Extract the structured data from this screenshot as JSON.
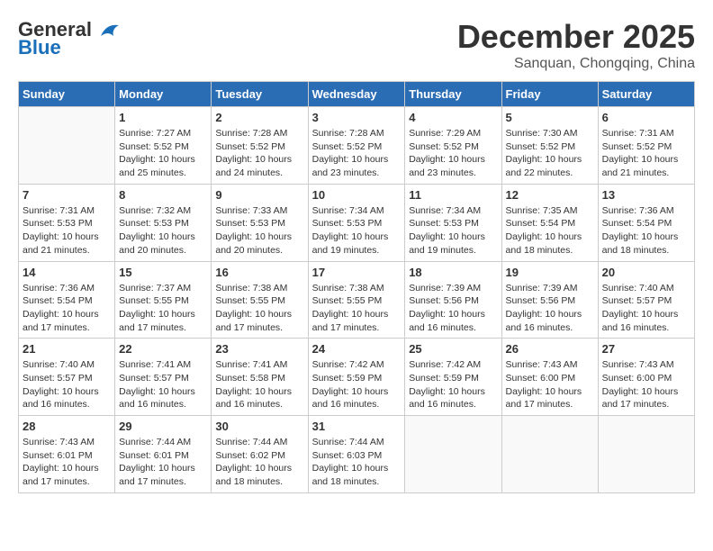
{
  "header": {
    "logo_line1": "General",
    "logo_line2": "Blue",
    "month": "December 2025",
    "location": "Sanquan, Chongqing, China"
  },
  "weekdays": [
    "Sunday",
    "Monday",
    "Tuesday",
    "Wednesday",
    "Thursday",
    "Friday",
    "Saturday"
  ],
  "weeks": [
    [
      {
        "day": "",
        "info": ""
      },
      {
        "day": "1",
        "info": "Sunrise: 7:27 AM\nSunset: 5:52 PM\nDaylight: 10 hours\nand 25 minutes."
      },
      {
        "day": "2",
        "info": "Sunrise: 7:28 AM\nSunset: 5:52 PM\nDaylight: 10 hours\nand 24 minutes."
      },
      {
        "day": "3",
        "info": "Sunrise: 7:28 AM\nSunset: 5:52 PM\nDaylight: 10 hours\nand 23 minutes."
      },
      {
        "day": "4",
        "info": "Sunrise: 7:29 AM\nSunset: 5:52 PM\nDaylight: 10 hours\nand 23 minutes."
      },
      {
        "day": "5",
        "info": "Sunrise: 7:30 AM\nSunset: 5:52 PM\nDaylight: 10 hours\nand 22 minutes."
      },
      {
        "day": "6",
        "info": "Sunrise: 7:31 AM\nSunset: 5:52 PM\nDaylight: 10 hours\nand 21 minutes."
      }
    ],
    [
      {
        "day": "7",
        "info": "Sunrise: 7:31 AM\nSunset: 5:53 PM\nDaylight: 10 hours\nand 21 minutes."
      },
      {
        "day": "8",
        "info": "Sunrise: 7:32 AM\nSunset: 5:53 PM\nDaylight: 10 hours\nand 20 minutes."
      },
      {
        "day": "9",
        "info": "Sunrise: 7:33 AM\nSunset: 5:53 PM\nDaylight: 10 hours\nand 20 minutes."
      },
      {
        "day": "10",
        "info": "Sunrise: 7:34 AM\nSunset: 5:53 PM\nDaylight: 10 hours\nand 19 minutes."
      },
      {
        "day": "11",
        "info": "Sunrise: 7:34 AM\nSunset: 5:53 PM\nDaylight: 10 hours\nand 19 minutes."
      },
      {
        "day": "12",
        "info": "Sunrise: 7:35 AM\nSunset: 5:54 PM\nDaylight: 10 hours\nand 18 minutes."
      },
      {
        "day": "13",
        "info": "Sunrise: 7:36 AM\nSunset: 5:54 PM\nDaylight: 10 hours\nand 18 minutes."
      }
    ],
    [
      {
        "day": "14",
        "info": "Sunrise: 7:36 AM\nSunset: 5:54 PM\nDaylight: 10 hours\nand 17 minutes."
      },
      {
        "day": "15",
        "info": "Sunrise: 7:37 AM\nSunset: 5:55 PM\nDaylight: 10 hours\nand 17 minutes."
      },
      {
        "day": "16",
        "info": "Sunrise: 7:38 AM\nSunset: 5:55 PM\nDaylight: 10 hours\nand 17 minutes."
      },
      {
        "day": "17",
        "info": "Sunrise: 7:38 AM\nSunset: 5:55 PM\nDaylight: 10 hours\nand 17 minutes."
      },
      {
        "day": "18",
        "info": "Sunrise: 7:39 AM\nSunset: 5:56 PM\nDaylight: 10 hours\nand 16 minutes."
      },
      {
        "day": "19",
        "info": "Sunrise: 7:39 AM\nSunset: 5:56 PM\nDaylight: 10 hours\nand 16 minutes."
      },
      {
        "day": "20",
        "info": "Sunrise: 7:40 AM\nSunset: 5:57 PM\nDaylight: 10 hours\nand 16 minutes."
      }
    ],
    [
      {
        "day": "21",
        "info": "Sunrise: 7:40 AM\nSunset: 5:57 PM\nDaylight: 10 hours\nand 16 minutes."
      },
      {
        "day": "22",
        "info": "Sunrise: 7:41 AM\nSunset: 5:57 PM\nDaylight: 10 hours\nand 16 minutes."
      },
      {
        "day": "23",
        "info": "Sunrise: 7:41 AM\nSunset: 5:58 PM\nDaylight: 10 hours\nand 16 minutes."
      },
      {
        "day": "24",
        "info": "Sunrise: 7:42 AM\nSunset: 5:59 PM\nDaylight: 10 hours\nand 16 minutes."
      },
      {
        "day": "25",
        "info": "Sunrise: 7:42 AM\nSunset: 5:59 PM\nDaylight: 10 hours\nand 16 minutes."
      },
      {
        "day": "26",
        "info": "Sunrise: 7:43 AM\nSunset: 6:00 PM\nDaylight: 10 hours\nand 17 minutes."
      },
      {
        "day": "27",
        "info": "Sunrise: 7:43 AM\nSunset: 6:00 PM\nDaylight: 10 hours\nand 17 minutes."
      }
    ],
    [
      {
        "day": "28",
        "info": "Sunrise: 7:43 AM\nSunset: 6:01 PM\nDaylight: 10 hours\nand 17 minutes."
      },
      {
        "day": "29",
        "info": "Sunrise: 7:44 AM\nSunset: 6:01 PM\nDaylight: 10 hours\nand 17 minutes."
      },
      {
        "day": "30",
        "info": "Sunrise: 7:44 AM\nSunset: 6:02 PM\nDaylight: 10 hours\nand 18 minutes."
      },
      {
        "day": "31",
        "info": "Sunrise: 7:44 AM\nSunset: 6:03 PM\nDaylight: 10 hours\nand 18 minutes."
      },
      {
        "day": "",
        "info": ""
      },
      {
        "day": "",
        "info": ""
      },
      {
        "day": "",
        "info": ""
      }
    ]
  ]
}
